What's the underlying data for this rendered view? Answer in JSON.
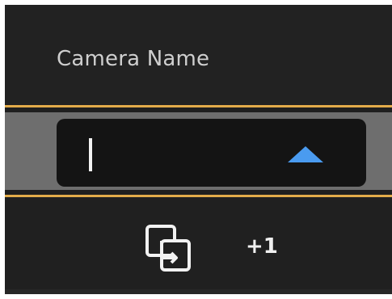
{
  "column": {
    "title": "Camera Name"
  },
  "editor": {
    "value": "",
    "toggle_icon": "triangle-up-icon",
    "toggle_color": "#4a9bf0"
  },
  "row_actions": {
    "linked_icon": "open-in-new-icon",
    "linked_count_label": "+1"
  },
  "colors": {
    "selection_border": "#e3ac4a",
    "panel_background": "#202020"
  }
}
